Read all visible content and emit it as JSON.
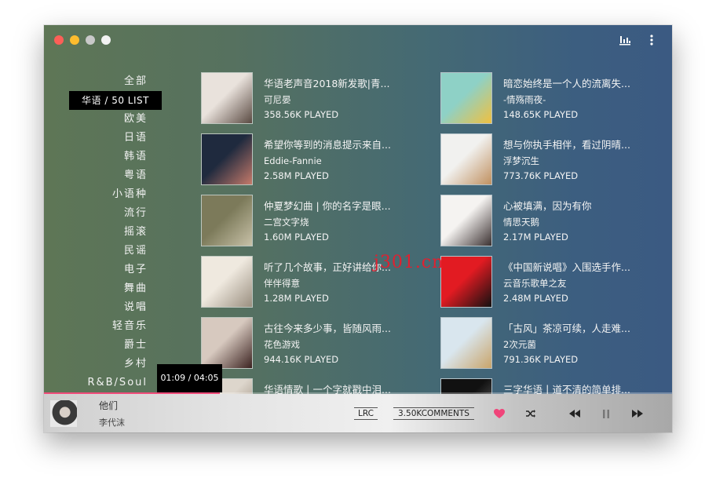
{
  "categories": [
    "全部",
    "华语 / 50 LIST",
    "欧美",
    "日语",
    "韩语",
    "粤语",
    "小语种",
    "流行",
    "摇滚",
    "民谣",
    "电子",
    "舞曲",
    "说唱",
    "轻音乐",
    "爵士",
    "乡村",
    "R&B/Soul"
  ],
  "active_category_index": 1,
  "time_tooltip": "01:09 / 04:05",
  "playlists": [
    {
      "title": "华语老声音2018新发歌|青...",
      "author": "可尼晏",
      "played": "358.56K PLAYED",
      "color_a": "#e9e2dc",
      "color_b": "#5a4a42"
    },
    {
      "title": "暗恋始终是一个人的流离失...",
      "author": "-情殇雨夜-",
      "played": "148.65K PLAYED",
      "color_a": "#8ed1c6",
      "color_b": "#f0c040"
    },
    {
      "title": "希望你等到的消息提示来自...",
      "author": "Eddie-Fannie",
      "played": "2.58M PLAYED",
      "color_a": "#1f2a3e",
      "color_b": "#c57a6a"
    },
    {
      "title": "想与你执手相伴，看过阴晴...",
      "author": "浮梦沉生",
      "played": "773.76K PLAYED",
      "color_a": "#f1f1ef",
      "color_b": "#c09060"
    },
    {
      "title": "仲夏梦幻曲 | 你的名字是眼...",
      "author": "二宫文字烧",
      "played": "1.60M PLAYED",
      "color_a": "#7c7a5a",
      "color_b": "#c8c1a8"
    },
    {
      "title": "心被填满，因为有你",
      "author": "情思天鹅",
      "played": "2.17M PLAYED",
      "color_a": "#f5f3f1",
      "color_b": "#3a3030"
    },
    {
      "title": "听了几个故事，正好讲给你...",
      "author": "伴伴得意",
      "played": "1.28M PLAYED",
      "color_a": "#efe9df",
      "color_b": "#9a8f80"
    },
    {
      "title": "《中国新说唱》入围选手作...",
      "author": "云音乐歌单之友",
      "played": "2.48M PLAYED",
      "color_a": "#e21b22",
      "color_b": "#111111"
    },
    {
      "title": "古往今来多少事，皆随风雨...",
      "author": "花色游戏",
      "played": "944.16K PLAYED",
      "color_a": "#d7c9bf",
      "color_b": "#3b2220"
    },
    {
      "title": "「古风」茶凉可续，人走难...",
      "author": "2次元菌",
      "played": "791.36K PLAYED",
      "color_a": "#d9e6ee",
      "color_b": "#c9a46a"
    },
    {
      "title": "华语情歌丨一个字就戳中泪...",
      "author": "",
      "played": "",
      "color_a": "#ddd6cc",
      "color_b": "#8a7a6a"
    },
    {
      "title": "三字华语丨道不清的简单排...",
      "author": "",
      "played": "",
      "color_a": "#111111",
      "color_b": "#777777"
    }
  ],
  "watermark": "j301.cn",
  "player": {
    "song": "他们",
    "artist": "李代沫",
    "lrc_label": "LRC",
    "comments_label": "3.50KCOMMENTS",
    "progress_fraction": 0.28
  },
  "colors": {
    "heart": "#f0457a",
    "accent": "#f04b7a"
  }
}
